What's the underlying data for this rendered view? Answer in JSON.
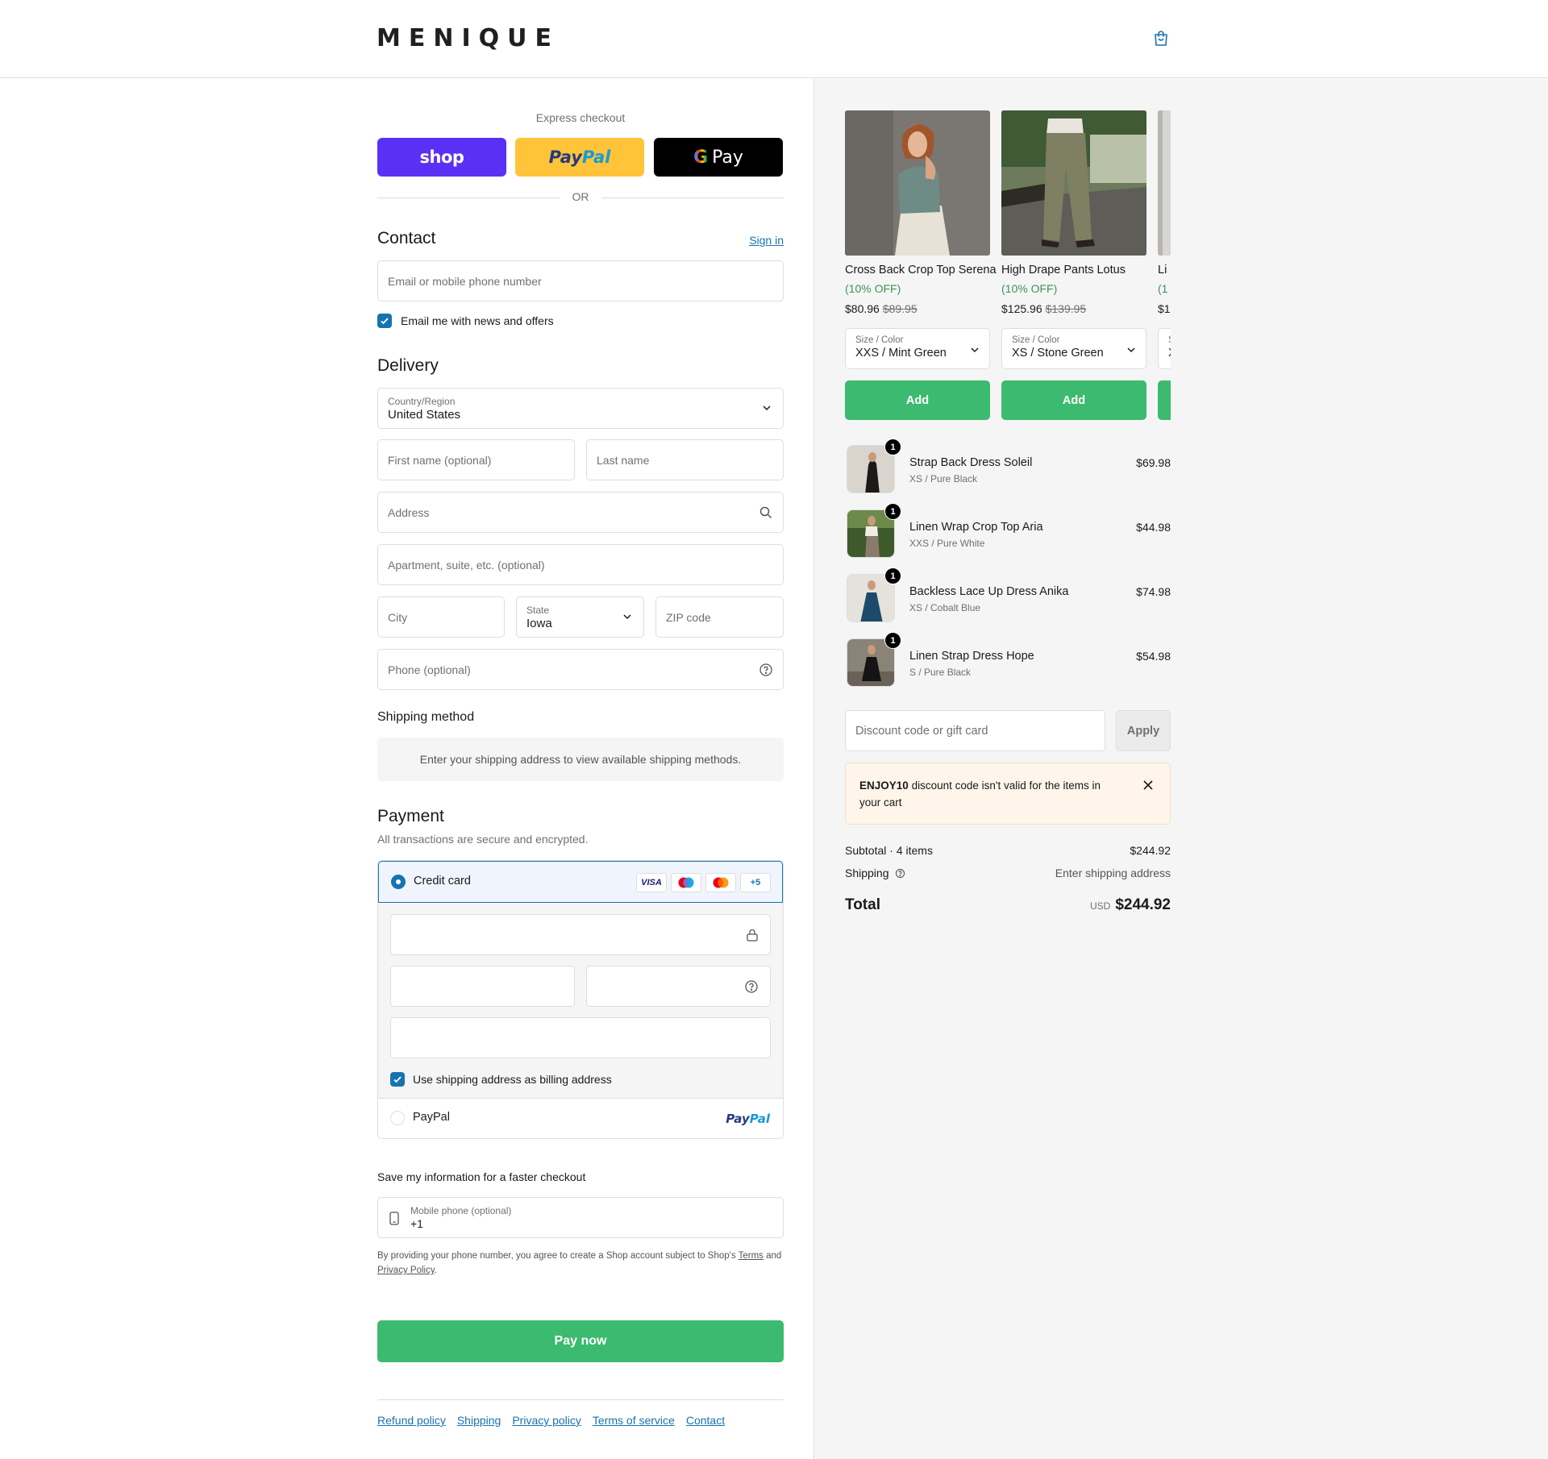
{
  "brand": {
    "name": "MENIQUE",
    "accent": "#1773b0",
    "green": "#3cba6f"
  },
  "express": {
    "label": "Express checkout",
    "shop_label": "shop",
    "paypal_label_1": "Pay",
    "paypal_label_2": "Pal",
    "gpay_g": "G",
    "gpay_label": "Pay",
    "or": "OR"
  },
  "contact": {
    "title": "Contact",
    "sign_in": "Sign in",
    "email_placeholder": "Email or mobile phone number",
    "news_label": "Email me with news and offers",
    "news_checked": true
  },
  "delivery": {
    "title": "Delivery",
    "country_label": "Country/Region",
    "country_value": "United States",
    "first_name_placeholder": "First name (optional)",
    "last_name_placeholder": "Last name",
    "address_placeholder": "Address",
    "apartment_placeholder": "Apartment, suite, etc. (optional)",
    "city_placeholder": "City",
    "state_label": "State",
    "state_value": "Iowa",
    "zip_placeholder": "ZIP code",
    "phone_placeholder": "Phone (optional)"
  },
  "shipping_method": {
    "title": "Shipping method",
    "message": "Enter your shipping address to view available shipping methods."
  },
  "payment": {
    "title": "Payment",
    "subtitle": "All transactions are secure and encrypted.",
    "credit_card_label": "Credit card",
    "card_brands": [
      "VISA",
      "maestro",
      "mastercard"
    ],
    "more_cards": "+5",
    "billing_label": "Use shipping address as billing address",
    "billing_checked": true,
    "paypal_label": "PayPal",
    "paypal_logo_1": "Pay",
    "paypal_logo_2": "Pal"
  },
  "save_info": {
    "title": "Save my information for a faster checkout",
    "mobile_label": "Mobile phone (optional)",
    "mobile_value": "+1",
    "fine_print_1": "By providing your phone number, you agree to create a Shop account subject to Shop's",
    "terms_link": "Terms",
    "fine_print_2": "and",
    "privacy_link": "Privacy Policy",
    "fine_print_3": "."
  },
  "pay_now": "Pay now",
  "footer": {
    "links": [
      "Refund policy",
      "Shipping",
      "Privacy policy",
      "Terms of service",
      "Contact"
    ]
  },
  "upsell": [
    {
      "name": "Cross Back Crop Top Serena",
      "discount": "(10% OFF)",
      "price": "$80.96",
      "old_price": "$89.95",
      "variant_label": "Size / Color",
      "variant_value": "XXS / Mint Green",
      "add_label": "Add"
    },
    {
      "name": "High Drape Pants Lotus",
      "discount": "(10% OFF)",
      "price": "$125.96",
      "old_price": "$139.95",
      "variant_label": "Size / Color",
      "variant_value": "XS / Stone Green",
      "add_label": "Add"
    },
    {
      "name": "Li",
      "discount": "(1",
      "price": "$1",
      "old_price": "",
      "variant_label": "S",
      "variant_value": "X",
      "add_label": ""
    }
  ],
  "cart_items": [
    {
      "qty": "1",
      "name": "Strap Back Dress Soleil",
      "variant": "XS / Pure Black",
      "price": "$69.98"
    },
    {
      "qty": "1",
      "name": "Linen Wrap Crop Top Aria",
      "variant": "XXS / Pure White",
      "price": "$44.98"
    },
    {
      "qty": "1",
      "name": "Backless Lace Up Dress Anika",
      "variant": "XS / Cobalt Blue",
      "price": "$74.98"
    },
    {
      "qty": "1",
      "name": "Linen Strap Dress Hope",
      "variant": "S / Pure Black",
      "price": "$54.98"
    }
  ],
  "discount": {
    "placeholder": "Discount code or gift card",
    "apply_label": "Apply",
    "alert_code": "ENJOY10",
    "alert_text": "discount code isn't valid for the items in your cart"
  },
  "summary": {
    "subtotal_label": "Subtotal · 4 items",
    "subtotal_value": "$244.92",
    "shipping_label": "Shipping",
    "shipping_value": "Enter shipping address",
    "total_label": "Total",
    "total_currency": "USD",
    "total_value": "$244.92"
  }
}
